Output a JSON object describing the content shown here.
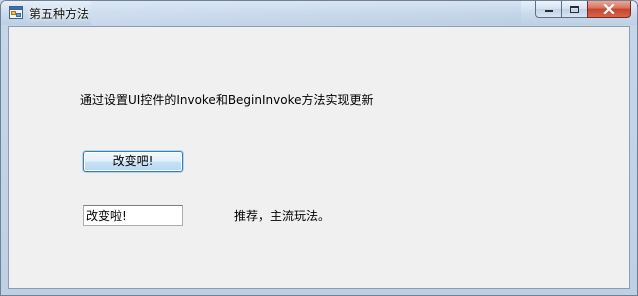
{
  "window": {
    "title": "第五种方法",
    "controls": {
      "minimize_icon": "minimize-icon",
      "maximize_icon": "maximize-icon",
      "close_icon": "close-icon"
    }
  },
  "form": {
    "description": "通过设置UI控件的Invoke和BeginInvoke方法实现更新",
    "change_button_label": "改变吧!",
    "text_field_value": "改变啦!",
    "recommend_text": "推荐，主流玩法。"
  },
  "colors": {
    "close_button": "#c2452c",
    "button_border": "#3c7fb1",
    "client_background": "#f0f0f0"
  }
}
